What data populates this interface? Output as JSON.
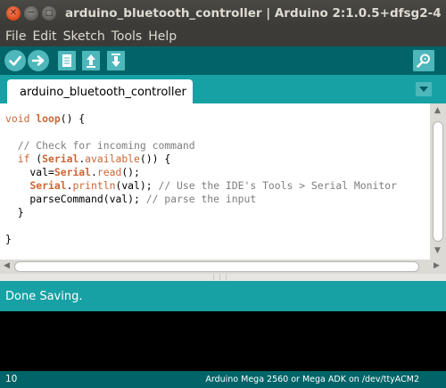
{
  "window": {
    "title": "arduino_bluetooth_controller | Arduino 2:1.0.5+dfsg2-4",
    "controls": [
      "close-icon",
      "minimize-icon",
      "maximize-icon"
    ]
  },
  "menu": {
    "items": [
      "File",
      "Edit",
      "Sketch",
      "Tools",
      "Help"
    ]
  },
  "toolbar": {
    "buttons": [
      "verify-icon",
      "upload-icon",
      "new-icon",
      "open-icon",
      "save-icon",
      "serial-monitor-icon"
    ]
  },
  "tabs": {
    "active_label": "arduino_bluetooth_controller"
  },
  "editor": {
    "code": [
      "void loop() {",
      "",
      "  // Check for incoming command",
      "  if (Serial.available()) {",
      "    val=Serial.read();",
      "    Serial.println(val); // Use the IDE's Tools > Serial Monitor",
      "    parseCommand(val); // parse the input",
      "  }",
      "",
      "}"
    ]
  },
  "status": {
    "message": "Done Saving."
  },
  "footer": {
    "line_number": "10",
    "board": "Arduino Mega 2560 or Mega ADK on /dev/ttyACM2"
  },
  "colors": {
    "toolbar": "#006468",
    "accent": "#17a1a5",
    "button": "#4db7bb",
    "keyword": "#cc6633",
    "comment": "#7e7e7e"
  }
}
